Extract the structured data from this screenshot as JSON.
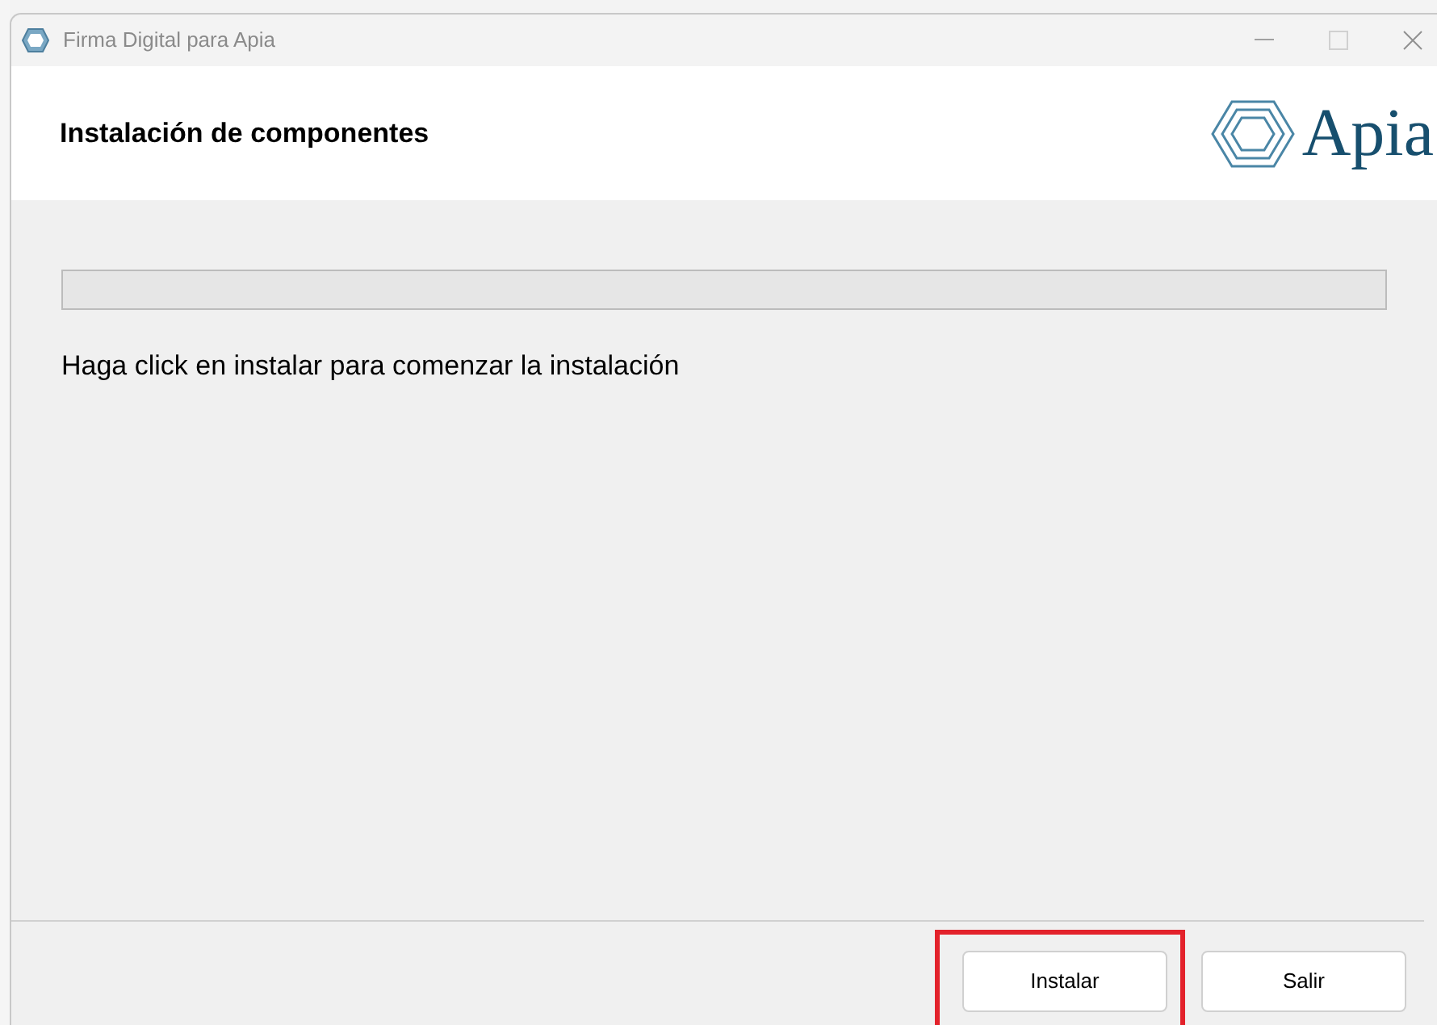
{
  "window": {
    "title": "Firma Digital para Apia"
  },
  "header": {
    "title": "Instalación de componentes",
    "logo_text": "Apia"
  },
  "progress": {
    "level": 0
  },
  "message": "Haga click en instalar para comenzar la instalación",
  "buttons": [
    {
      "label": "Instalar",
      "highlighted": true
    },
    {
      "label": "Salir",
      "highlighted": false
    }
  ]
}
